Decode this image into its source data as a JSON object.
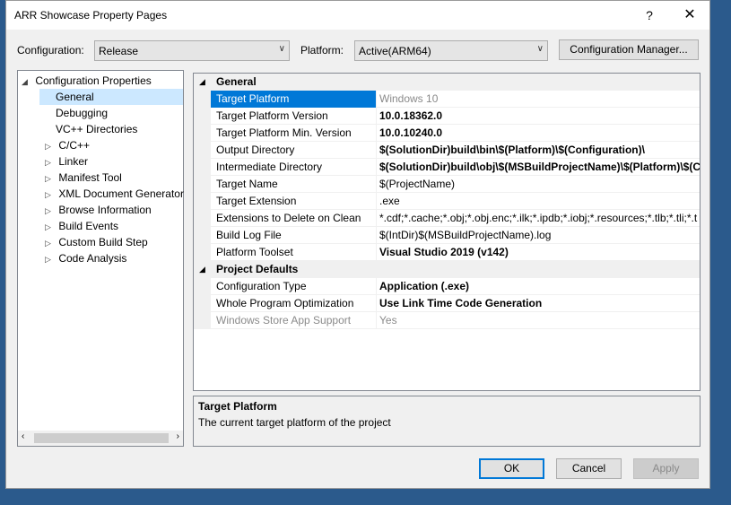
{
  "window": {
    "title": "ARR Showcase Property Pages",
    "help": "?",
    "close": "✕"
  },
  "config": {
    "configuration_label": "Configuration:",
    "configuration_value": "Release",
    "platform_label": "Platform:",
    "platform_value": "Active(ARM64)",
    "manager_button": "Configuration Manager..."
  },
  "tree": {
    "root": "Configuration Properties",
    "items": [
      {
        "label": "General",
        "expandable": false
      },
      {
        "label": "Debugging",
        "expandable": false
      },
      {
        "label": "VC++ Directories",
        "expandable": false
      },
      {
        "label": "C/C++",
        "expandable": true
      },
      {
        "label": "Linker",
        "expandable": true
      },
      {
        "label": "Manifest Tool",
        "expandable": true
      },
      {
        "label": "XML Document Generator",
        "expandable": true
      },
      {
        "label": "Browse Information",
        "expandable": true
      },
      {
        "label": "Build Events",
        "expandable": true
      },
      {
        "label": "Custom Build Step",
        "expandable": true
      },
      {
        "label": "Code Analysis",
        "expandable": true
      }
    ],
    "selected": "General"
  },
  "grid": {
    "categories": [
      {
        "name": "General",
        "rows": [
          {
            "name": "Target Platform",
            "value": "Windows 10"
          },
          {
            "name": "Target Platform Version",
            "value": "10.0.18362.0"
          },
          {
            "name": "Target Platform Min. Version",
            "value": "10.0.10240.0"
          },
          {
            "name": "Output Directory",
            "value": "$(SolutionDir)build\\bin\\$(Platform)\\$(Configuration)\\"
          },
          {
            "name": "Intermediate Directory",
            "value": "$(SolutionDir)build\\obj\\$(MSBuildProjectName)\\$(Platform)\\$(C"
          },
          {
            "name": "Target Name",
            "value": "$(ProjectName)"
          },
          {
            "name": "Target Extension",
            "value": ".exe"
          },
          {
            "name": "Extensions to Delete on Clean",
            "value": "*.cdf;*.cache;*.obj;*.obj.enc;*.ilk;*.ipdb;*.iobj;*.resources;*.tlb;*.tli;*.t"
          },
          {
            "name": "Build Log File",
            "value": "$(IntDir)$(MSBuildProjectName).log"
          },
          {
            "name": "Platform Toolset",
            "value": "Visual Studio 2019 (v142)"
          }
        ]
      },
      {
        "name": "Project Defaults",
        "rows": [
          {
            "name": "Configuration Type",
            "value": "Application (.exe)"
          },
          {
            "name": "Whole Program Optimization",
            "value": "Use Link Time Code Generation"
          },
          {
            "name": "Windows Store App Support",
            "value": "Yes"
          }
        ]
      }
    ]
  },
  "description": {
    "title": "Target Platform",
    "text": "The current target platform of the project"
  },
  "buttons": {
    "ok": "OK",
    "cancel": "Cancel",
    "apply": "Apply"
  },
  "colors": {
    "selection": "#0078d7",
    "tree_selection": "#cce8ff"
  }
}
